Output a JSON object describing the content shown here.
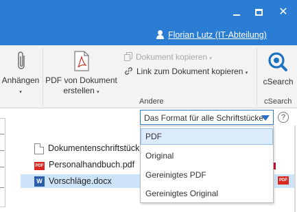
{
  "window": {
    "minimize_glyph": "",
    "maximize_glyph": "",
    "close_glyph": "✕",
    "user_name": "Florian Lutz (IT-Abteilung)"
  },
  "ribbon": {
    "attach": {
      "label": "Anhängen",
      "caret": "▾"
    },
    "pdf": {
      "label_line1": "PDF von Dokument",
      "label_line2": "erstellen",
      "caret": "▾"
    },
    "copy_document": {
      "label": "Dokument kopieren",
      "caret": "▾"
    },
    "copy_link": {
      "label": "Link zum Dokument kopieren",
      "caret": "▾"
    },
    "group_andere": "Andere",
    "csearch_button": "cSearch",
    "group_csearch": "cSearch"
  },
  "format_select": {
    "value": "Das Format für alle Schriftstücke",
    "options": [
      "PDF",
      "Original",
      "Gereinigtes PDF",
      "Gereinigtes Original"
    ],
    "highlighted_index": 0
  },
  "help_glyph": "?",
  "files": [
    {
      "name": "Dokumentenschriftstück",
      "icon": "document-icon"
    },
    {
      "name": "Personalhandbuch.pdf",
      "icon": "pdf-icon"
    },
    {
      "name": "Vorschläge.docx",
      "icon": "word-icon",
      "selected": true
    }
  ],
  "icon_text": {
    "pdf": "PDF",
    "word": "W"
  },
  "colors": {
    "title_bar": "#2b7cd3",
    "selection": "#cde3f8",
    "pdf_red": "#d8281f",
    "word_blue": "#2b5faa"
  }
}
